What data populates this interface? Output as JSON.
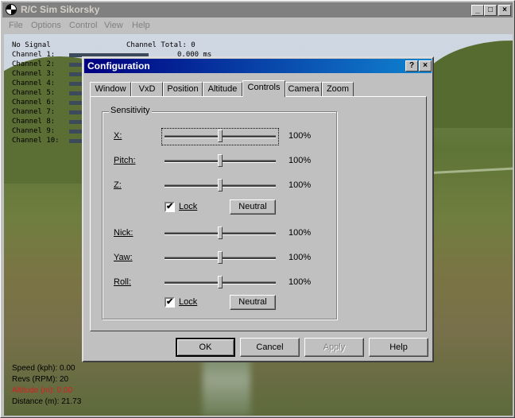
{
  "app": {
    "title": "R/C Sim Sikorsky",
    "minimize": "_",
    "maximize": "□",
    "close": "×"
  },
  "menu": [
    "File",
    "Options",
    "Control",
    "View",
    "Help"
  ],
  "hud": {
    "status": "No Signal",
    "channel_total_label": "Channel Total: 0",
    "channel_1_value": "0.000 ms",
    "channels": [
      "Channel  1:",
      "Channel  2:",
      "Channel  3:",
      "Channel  4:",
      "Channel  5:",
      "Channel  6:",
      "Channel  7:",
      "Channel  8:",
      "Channel  9:",
      "Channel 10:"
    ],
    "speed": "Speed (kph): 0.00",
    "revs": "Revs (RPM): 20",
    "altitude": "Altitude (m): 0.00",
    "distance": "Distance (m): 21.73"
  },
  "dialog": {
    "title": "Configuration",
    "help_btn": "?",
    "close_btn": "×",
    "tabs": [
      "Window",
      "VxD",
      "Position",
      "Altitude",
      "Controls",
      "Camera",
      "Zoom"
    ],
    "active_tab": "Controls",
    "group_title": "Sensitivity",
    "controls": [
      {
        "label": "X:",
        "value": "100%",
        "level": 0.5
      },
      {
        "label": "Pitch:",
        "value": "100%",
        "level": 0.5
      },
      {
        "label": "Z:",
        "value": "100%",
        "level": 0.5
      },
      {
        "label": "Nick:",
        "value": "100%",
        "level": 0.5
      },
      {
        "label": "Yaw:",
        "value": "100%",
        "level": 0.5
      },
      {
        "label": "Roll:",
        "value": "100%",
        "level": 0.5
      }
    ],
    "lock_label": "Lock",
    "lock1_checked": true,
    "lock2_checked": true,
    "check_glyph": "✔",
    "neutral_label": "Neutral",
    "ok": "OK",
    "cancel": "Cancel",
    "apply": "Apply",
    "help": "Help"
  },
  "colors": {
    "title_active": "#000080",
    "title_inactive": "#808080",
    "altitude_text": "#d82020"
  }
}
